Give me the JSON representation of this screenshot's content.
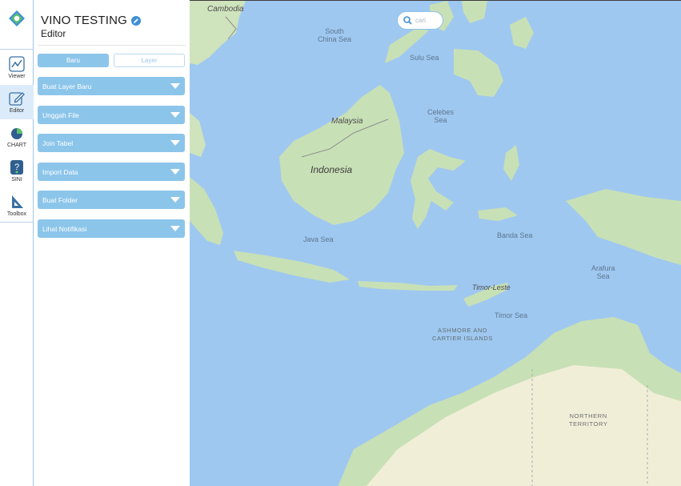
{
  "rail": {
    "items": [
      {
        "label": "Viewer"
      },
      {
        "label": "Editor"
      },
      {
        "label": "CHART"
      },
      {
        "label": "SINI"
      },
      {
        "label": "Toolbox"
      }
    ]
  },
  "panel": {
    "title": "VINO TESTING",
    "subtitle": "Editor",
    "tabs": {
      "baru": "Baru",
      "layer": "Layer"
    },
    "accordion": [
      "Buat Layer Baru",
      "Unggah File",
      "Join Tabel",
      "Import Data",
      "Buat Folder",
      "Lihat Notifikasi"
    ]
  },
  "map": {
    "search": {
      "placeholder": "cari"
    },
    "labels": {
      "cambodia": "Cambodia",
      "south_china_sea_1": "South",
      "south_china_sea_2": "China Sea",
      "sulu_sea": "Sulu Sea",
      "celebes_1": "Celebes",
      "celebes_2": "Sea",
      "malaysia": "Malaysia",
      "indonesia": "Indonesia",
      "java_sea": "Java Sea",
      "banda_sea": "Banda Sea",
      "arafura_1": "Arafura",
      "arafura_2": "Sea",
      "timor_leste": "Timor-Leste",
      "timor_sea": "Timor Sea",
      "ashmore_1": "ASHMORE AND",
      "ashmore_2": "CARTIER ISLANDS",
      "nt_1": "NORTHERN",
      "nt_2": "TERRITORY"
    },
    "colors": {
      "water": "#9fc8f0",
      "land": "#c8e0b6",
      "land_dry": "#f1eed8"
    }
  }
}
